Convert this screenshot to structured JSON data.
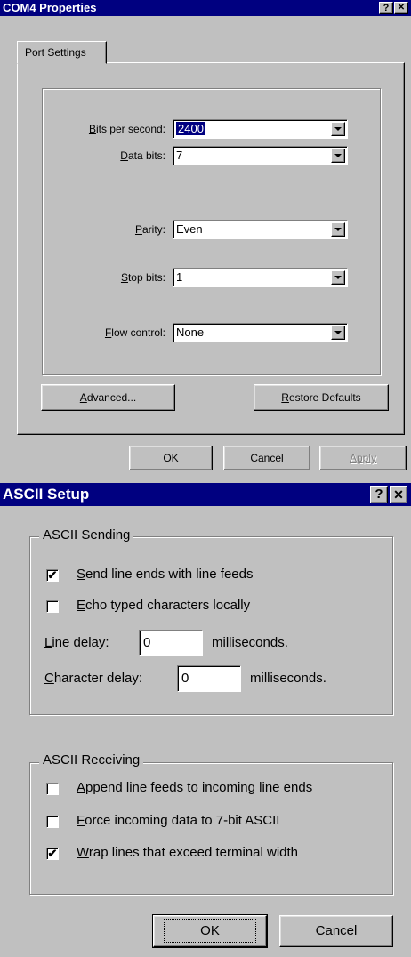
{
  "com4": {
    "title": "COM4 Properties",
    "help_btn": "?",
    "close_btn": "✕",
    "tab": "Port Settings",
    "fields": [
      {
        "label_pre": "",
        "label_key": "B",
        "label_post": "its per second:",
        "value": "2400"
      },
      {
        "label_pre": "",
        "label_key": "D",
        "label_post": "ata bits:",
        "value": "7"
      },
      {
        "label_pre": "",
        "label_key": "P",
        "label_post": "arity:",
        "value": "Even"
      },
      {
        "label_pre": "",
        "label_key": "S",
        "label_post": "top bits:",
        "value": "1"
      },
      {
        "label_pre": "",
        "label_key": "F",
        "label_post": "low control:",
        "value": "None"
      }
    ],
    "advanced": {
      "key": "A",
      "rest": "dvanced..."
    },
    "restore": {
      "key": "R",
      "rest": "estore Defaults"
    },
    "ok": "OK",
    "cancel": "Cancel",
    "apply": "Apply"
  },
  "ascii": {
    "title": "ASCII Setup",
    "help_btn": "?",
    "close_btn": "✕",
    "sending_group": "ASCII Sending",
    "send_line_ends": {
      "key": "S",
      "rest": "end line ends with line feeds",
      "checked": "✔"
    },
    "echo_typed": {
      "key": "E",
      "rest": "cho typed characters locally",
      "checked": ""
    },
    "line_delay": {
      "key": "L",
      "rest": "ine delay:",
      "value": "0",
      "unit": "milliseconds."
    },
    "char_delay": {
      "key": "C",
      "rest": "haracter delay:",
      "value": "0",
      "unit": "milliseconds."
    },
    "receiving_group": "ASCII Receiving",
    "append_lf": {
      "key": "A",
      "rest": "ppend line feeds to incoming line ends",
      "checked": ""
    },
    "force_7bit": {
      "key": "F",
      "rest": "orce incoming data to 7-bit ASCII",
      "checked": ""
    },
    "wrap_lines": {
      "key": "W",
      "rest": "rap lines that exceed terminal width",
      "checked": "✔"
    },
    "ok": "OK",
    "cancel": "Cancel"
  }
}
